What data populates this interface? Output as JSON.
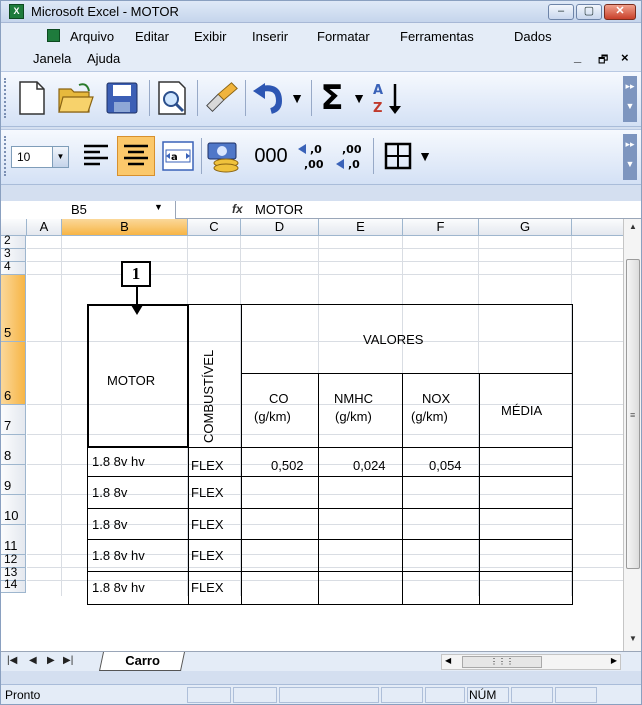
{
  "window": {
    "title": "Microsoft Excel - MOTOR",
    "app_icon": "excel-icon",
    "buttons": {
      "minimize": "–",
      "restore": "▢",
      "close": "✕"
    }
  },
  "menu": {
    "file": "Arquivo",
    "edit": "Editar",
    "view": "Exibir",
    "insert": "Inserir",
    "format": "Formatar",
    "tools": "Ferramentas",
    "data": "Dados",
    "window": "Janela",
    "help": "Ajuda",
    "doc_min": "_",
    "doc_restore": "🗗",
    "doc_close": "×"
  },
  "toolbar2": {
    "font_size": "10",
    "thousands": "000"
  },
  "formula_bar": {
    "name_box": "B5",
    "fx": "fx",
    "value": "MOTOR"
  },
  "columns": [
    "A",
    "B",
    "C",
    "D",
    "E",
    "F",
    "G"
  ],
  "rows": [
    "2",
    "3",
    "4",
    "5",
    "6",
    "7",
    "8",
    "9",
    "10",
    "11",
    "12",
    "13",
    "14"
  ],
  "table": {
    "motor_header": "MOTOR",
    "fuel_header": "COMBUSTÍVEL",
    "values_header": "VALORES",
    "co": "CO",
    "co_unit": "(g/km)",
    "nmhc": "NMHC",
    "nmhc_unit": "(g/km)",
    "nox": "NOX",
    "nox_unit": "(g/km)",
    "media": "MÉDIA",
    "rows": [
      {
        "motor": "1.8 8v hv",
        "fuel": "FLEX",
        "co": "0,502",
        "nmhc": "0,024",
        "nox": "0,054"
      },
      {
        "motor": "1.8 8v",
        "fuel": "FLEX"
      },
      {
        "motor": "1.8 8v",
        "fuel": "FLEX"
      },
      {
        "motor": "1.8 8v hv",
        "fuel": "FLEX"
      },
      {
        "motor": "1.8 8v hv",
        "fuel": "FLEX"
      }
    ]
  },
  "callout": "1",
  "sheet_tab": "Carro",
  "status": {
    "ready": "Pronto",
    "num": "NÚM"
  }
}
